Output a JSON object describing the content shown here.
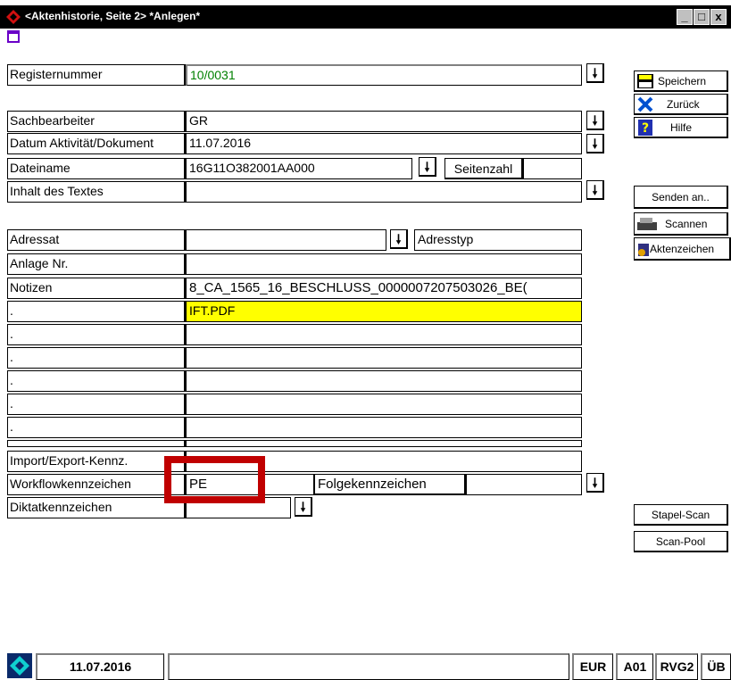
{
  "window": {
    "title": "<Aktenhistorie, Seite 2>  *Anlegen*",
    "controls": [
      "_",
      "□",
      "x"
    ]
  },
  "form": {
    "registernummer": {
      "label": "Registernummer",
      "value": "10/0031"
    },
    "sachbearbeiter": {
      "label": "Sachbearbeiter",
      "value": "GR"
    },
    "datum": {
      "label": "Datum Aktivität/Dokument",
      "value": "11.07.2016"
    },
    "dateiname": {
      "label": "Dateiname",
      "value": "16G11O382001AA000",
      "seitenzahl_label": "Seitenzahl",
      "seitenzahl_value": ""
    },
    "inhalt": {
      "label": "Inhalt des Textes",
      "value": ""
    },
    "adressat": {
      "label": "Adressat",
      "value": "",
      "adresstyp_label": "Adresstyp"
    },
    "anlage": {
      "label": "Anlage Nr.",
      "value": ""
    },
    "notizen": {
      "label": "Notizen",
      "lines": [
        "8_CA_1565_16_BESCHLUSS_0000007207503026_BE(",
        "IFT.PDF",
        "",
        "",
        "",
        "",
        "",
        ""
      ],
      "line_labels": [
        ".",
        ".",
        ".",
        ".",
        ".",
        ".",
        "."
      ]
    },
    "import_export": {
      "label": "Import/Export-Kennz.",
      "value": ""
    },
    "workflow": {
      "label": "Workflowkennzeichen",
      "value": "PE",
      "folge_label": "Folgekennzeichen",
      "folge_value": ""
    },
    "diktat": {
      "label": "Diktatkennzeichen",
      "value": ""
    }
  },
  "side_buttons": {
    "speichern": "Speichern",
    "zurueck": "Zurück",
    "hilfe": "Hilfe",
    "senden": "Senden an..",
    "scannen": "Scannen",
    "aktenzeichen": "Aktenzeichen",
    "stapel_scan": "Stapel-Scan",
    "scan_pool": "Scan-Pool"
  },
  "status_bar": {
    "date": "11.07.2016",
    "message": "",
    "currency": "EUR",
    "code1": "A01",
    "code2": "RVG2",
    "code3": "ÜB"
  },
  "colors": {
    "highlight_yellow": "#ffff00",
    "annotation_red": "#c00000",
    "value_green": "#008000"
  }
}
